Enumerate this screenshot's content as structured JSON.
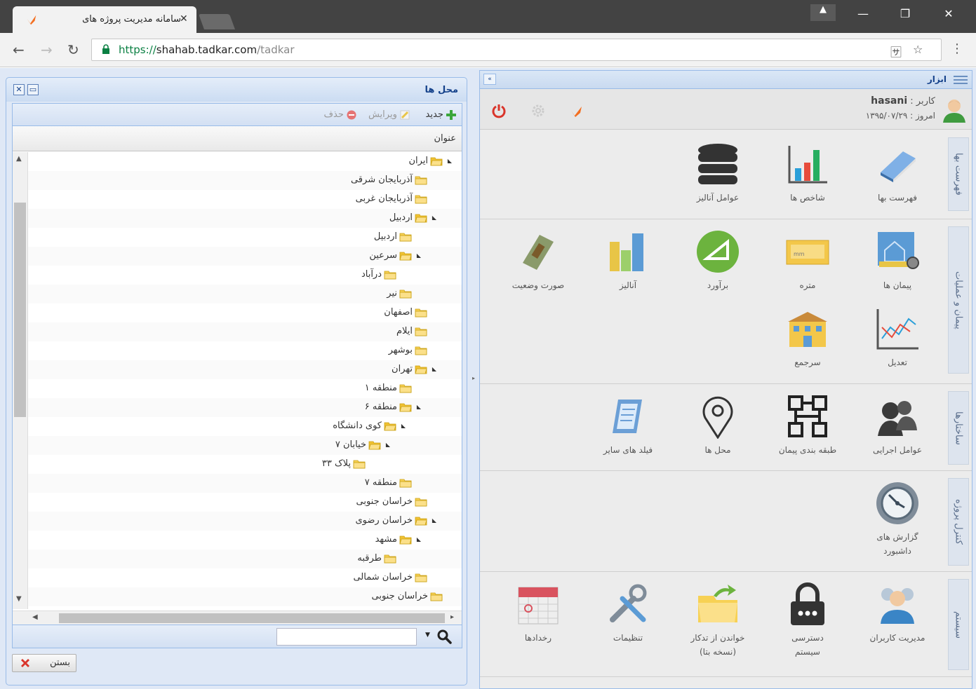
{
  "browser": {
    "tab_title": "سامانه مدیریت پروژه های",
    "url_scheme": "https://",
    "url_host": "shahab.tadkar.com",
    "url_path": "/tadkar"
  },
  "tools_panel": {
    "title": "ابزار",
    "user_label": "کاربر :",
    "username": "hasani",
    "date_label": "امروز : ۱۳۹۵/۰۷/۲۹",
    "sections": [
      {
        "tab": "فهرست بها",
        "items": [
          "فهرست بها",
          "شاخص ها",
          "عوامل آنالیز"
        ]
      },
      {
        "tab": "پیمان و عملیات",
        "items": [
          "پیمان ها",
          "متره",
          "برآورد",
          "آنالیز",
          "صورت وضعیت",
          "تعدیل",
          "سرجمع"
        ]
      },
      {
        "tab": "ساختارها",
        "items": [
          "عوامل اجرایی",
          "طبقه بندی پیمان",
          "محل ها",
          "فیلد های سایر"
        ]
      },
      {
        "tab": "کنترل پروژه",
        "items": [
          "گزارش های",
          "داشبورد"
        ]
      },
      {
        "tab": "سیستم",
        "items": [
          "مدیریت کاربران",
          "دسترسی",
          "سیستم",
          "خواندن از تدکار",
          "(نسخه بتا)",
          "تنظیمات",
          "رخدادها"
        ]
      }
    ]
  },
  "dialog": {
    "title": "محل ها",
    "toolbar": {
      "new": "جدید",
      "edit": "ویرایش",
      "delete": "حذف"
    },
    "column_header": "عنوان",
    "tree": [
      {
        "label": "ایران",
        "level": 0,
        "expanded": true
      },
      {
        "label": "آذربایجان شرقی",
        "level": 1
      },
      {
        "label": "آذربایجان غربی",
        "level": 1
      },
      {
        "label": "اردبیل",
        "level": 1,
        "expanded": true
      },
      {
        "label": "اردبیل",
        "level": 2
      },
      {
        "label": "سرعین",
        "level": 2,
        "expanded": true
      },
      {
        "label": "درآباد",
        "level": 3
      },
      {
        "label": "نیر",
        "level": 2
      },
      {
        "label": "اصفهان",
        "level": 1
      },
      {
        "label": "ایلام",
        "level": 1
      },
      {
        "label": "بوشهر",
        "level": 1
      },
      {
        "label": "تهران",
        "level": 1,
        "expanded": true
      },
      {
        "label": "منطقه ۱",
        "level": 2
      },
      {
        "label": "منطقه ۶",
        "level": 2,
        "expanded": true
      },
      {
        "label": "کوی دانشگاه",
        "level": 3,
        "expanded": true
      },
      {
        "label": "خیابان ۷",
        "level": 4,
        "expanded": true
      },
      {
        "label": "پلاک ۳۳",
        "level": 5
      },
      {
        "label": "منطقه ۷",
        "level": 2
      },
      {
        "label": "خراسان جنوبی",
        "level": 1
      },
      {
        "label": "خراسان رضوی",
        "level": 1,
        "expanded": true
      },
      {
        "label": "مشهد",
        "level": 2,
        "expanded": true
      },
      {
        "label": "طرقبه",
        "level": 3
      },
      {
        "label": "خراسان شمالی",
        "level": 1
      },
      {
        "label": "خراسان جنوبی",
        "level": 0
      }
    ],
    "search_placeholder": "",
    "close_label": "بستن"
  },
  "colors": {
    "chrome_dark": "#434343",
    "panel_border": "#99bbe8",
    "title_blue": "#15428b",
    "folder_yellow": "#f7d154",
    "accent_orange": "#f36f21",
    "power_red": "#d9352b"
  }
}
